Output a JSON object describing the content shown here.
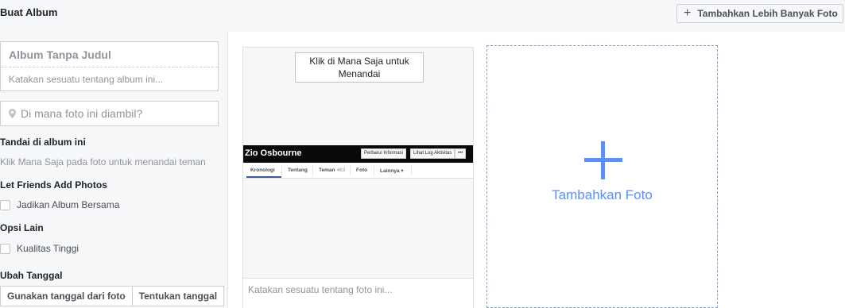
{
  "header": {
    "title": "Buat Album",
    "add_more_icon": "plus-icon",
    "add_more_label": "Tambahkan Lebih Banyak Foto"
  },
  "sidebar": {
    "album_title_placeholder": "Album Tanpa Judul",
    "album_desc_placeholder": "Katakan sesuatu tentang album ini...",
    "location_icon": "map-pin-icon",
    "location_placeholder": "Di mana foto ini diambil?",
    "tag_heading": "Tandai di album ini",
    "tag_helper": "Klik Mana Saja pada foto untuk menandai teman",
    "friends_heading": "Let Friends Add Photos",
    "shared_album_label": "Jadikan Album Bersama",
    "other_heading": "Opsi Lain",
    "high_quality_label": "Kualitas Tinggi",
    "date_heading": "Ubah Tanggal",
    "date_from_photo": "Gunakan tanggal dari foto",
    "date_set": "Tentukan tanggal"
  },
  "photo": {
    "tag_tooltip_line1": "Klik di Mana Saja untuk",
    "tag_tooltip_line2": "Menandai",
    "profile_name": "Zio Osbourne",
    "btn_update_info": "Perbarui Informasi",
    "btn_activity_log": "Lihat Log Aktivitas",
    "btn_more": "•••",
    "tabs": [
      {
        "label": "Kronologi",
        "count": ""
      },
      {
        "label": "Tentang",
        "count": ""
      },
      {
        "label": "Teman",
        "count": "463"
      },
      {
        "label": "Foto",
        "count": ""
      },
      {
        "label": "Lainnya ▾",
        "count": ""
      }
    ],
    "caption_placeholder": "Katakan sesuatu tentang foto ini..."
  },
  "add_photo": {
    "icon": "plus-icon",
    "label": "Tambahkan Foto",
    "accent_color": "#5890ff"
  }
}
